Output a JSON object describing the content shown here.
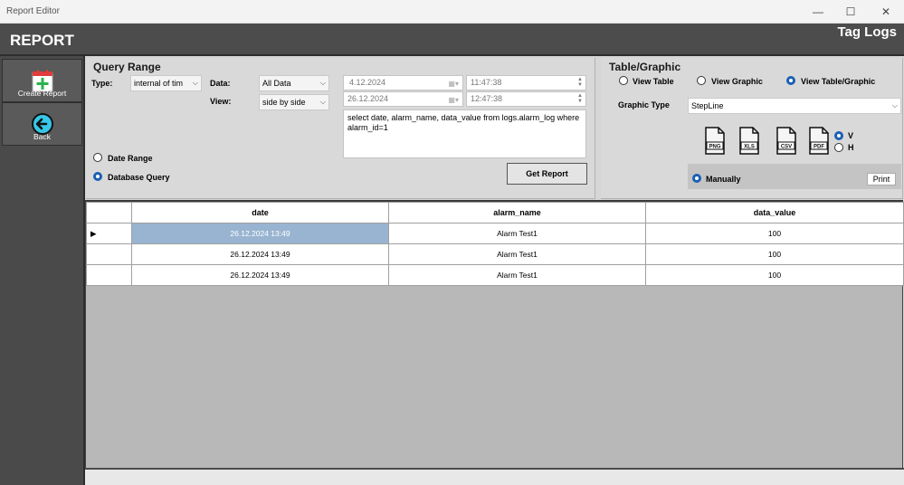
{
  "window": {
    "title": "Report Editor",
    "minimize": "—",
    "maximize": "☐",
    "close": "✕"
  },
  "header": {
    "app_title": "REPORT",
    "page_name": "Tag Logs"
  },
  "sidebar": {
    "create_label": "Create Report",
    "back_label": "Back"
  },
  "query_range": {
    "title": "Query Range",
    "type_label": "Type:",
    "type_value": "internal of tim",
    "data_label": "Data:",
    "data_value": "All Data",
    "view_label": "View:",
    "view_value": "side by side",
    "start_date": "4.12.2024",
    "start_time": "11:47:38",
    "end_date": "26.12.2024",
    "end_time": "12:47:38",
    "query_text": "select date, alarm_name, data_value from logs.alarm_log where alarm_id=1",
    "date_range_label": "Date Range",
    "database_query_label": "Database Query",
    "selected_mode": "Database Query",
    "get_report_label": "Get Report"
  },
  "table_graphic": {
    "title": "Table/Graphic",
    "view_table_label": "View Table",
    "view_graphic_label": "View Graphic",
    "view_both_label": "View Table/Graphic",
    "selected_view": "View Table/Graphic",
    "graphic_type_label": "Graphic Type",
    "graphic_type_value": "StepLine",
    "export_formats": [
      "PNG",
      "XLS",
      "CSV",
      "PDF"
    ],
    "orientation_v": "V",
    "orientation_h": "H",
    "selected_orientation": "V",
    "manually_label": "Manually",
    "print_label": "Print"
  },
  "grid": {
    "columns": [
      "date",
      "alarm_name",
      "data_value"
    ],
    "rows": [
      [
        "26.12.2024 13:49",
        "Alarm Test1",
        "100"
      ],
      [
        "26.12.2024 13:49",
        "Alarm Test1",
        "100"
      ],
      [
        "26.12.2024 13:49",
        "Alarm Test1",
        "100"
      ]
    ],
    "current_row_marker": "▶"
  },
  "colors": {
    "header_bg": "#4c4c4c",
    "sidebar_bg": "#4a4a4a",
    "selection": "#99b4d1",
    "radio_accent": "#1a5fb4"
  }
}
